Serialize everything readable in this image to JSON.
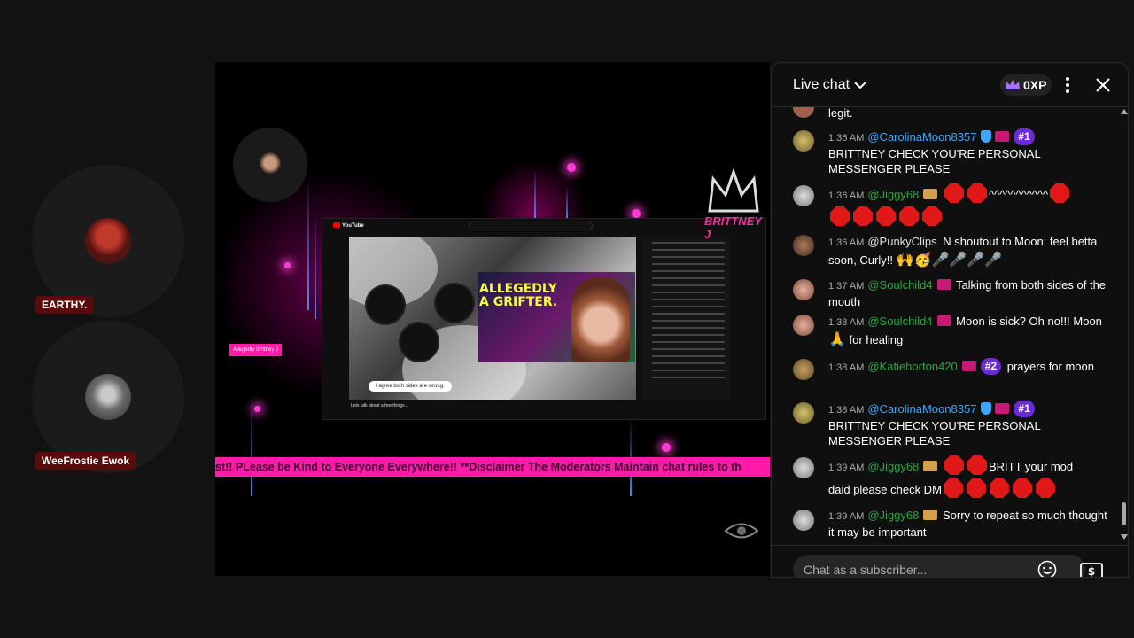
{
  "participants": [
    {
      "name": "EARTHY."
    },
    {
      "name": "WeeFrostie Ewok"
    }
  ],
  "video": {
    "ticker": "st!! PLease be Kind to Everyone Everywhere!! **Disclaimer The Moderators Maintain chat rules to th",
    "brand": "BRITTNEY J",
    "inner": {
      "logo": "YouTube",
      "headline": [
        "ALLEGEDLY",
        "A GRIFTER."
      ],
      "caption": "I agree both sides are wrong.",
      "title": "Lets talk about a few things...",
      "tag": "Allegedly Brittney J"
    }
  },
  "chat": {
    "title": "Live chat",
    "xp": "0XP",
    "input_placeholder": "Chat as a subscriber...",
    "messages": [
      {
        "time": "",
        "author": "",
        "text": "legit."
      },
      {
        "time": "1:36 AM",
        "author": "@CarolinaMoon8357",
        "rank": "#1",
        "text": "BRITTNEY CHECK YOU'RE PERSONAL MESSENGER PLEASE"
      },
      {
        "time": "1:36 AM",
        "author": "@Jiggy68",
        "text": "^^^^^^^^^^^"
      },
      {
        "time": "1:36 AM",
        "author": "@PunkyClips",
        "text": "N shoutout to Moon: feel betta soon, Curly!!"
      },
      {
        "time": "1:37 AM",
        "author": "@Soulchild4",
        "text": "Talking from both sides of the mouth"
      },
      {
        "time": "1:38 AM",
        "author": "@Soulchild4",
        "text": "Moon is sick? Oh no!!! Moon",
        "text2": "for healing"
      },
      {
        "time": "1:38 AM",
        "author": "@Katiehorton420",
        "rank": "#2",
        "text": "prayers for moon"
      },
      {
        "time": "1:38 AM",
        "author": "@CarolinaMoon8357",
        "rank": "#1",
        "text": "BRITTNEY CHECK YOU'RE PERSONAL MESSENGER PLEASE"
      },
      {
        "time": "1:39 AM",
        "author": "@Jiggy68",
        "text": "BRITT your mod",
        "text2": "daid please check DM"
      },
      {
        "time": "1:39 AM",
        "author": "@Jiggy68",
        "text": "Sorry to repeat so much thought it may be important"
      }
    ]
  },
  "icons": {
    "chevron": "chevron-down-icon",
    "crown": "crown-icon",
    "more": "more-vert-icon",
    "close": "close-icon",
    "emoji": "emoji-icon",
    "super_chat": "dollar-icon"
  },
  "colors": {
    "ticker_bg": "#ff1aa8",
    "rank_bg": "#6b2bd6",
    "link_blue": "#3ea6ff",
    "member_green": "#2ba640"
  }
}
